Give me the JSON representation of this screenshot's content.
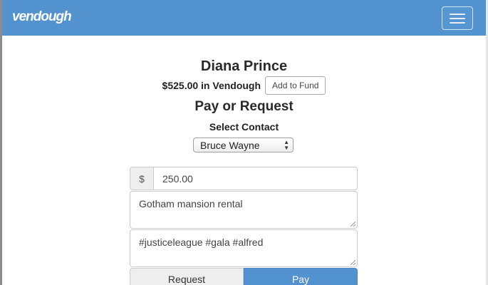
{
  "navbar": {
    "brand": "vendough",
    "menu_icon": "hamburger-icon",
    "background_color": "#5292cf"
  },
  "profile": {
    "name": "Diana Prince",
    "balance_text": "$525.00 in Vendough",
    "fund_button_label": "Add to Fund"
  },
  "transaction": {
    "title": "Pay or Request",
    "select_label": "Select Contact",
    "selected_contact": "Bruce Wayne",
    "currency_symbol": "$",
    "amount_value": "250.00",
    "description_value": "Gotham mansion rental",
    "tags_value": "#justiceleague #gala #alfred",
    "request_button_label": "Request",
    "pay_button_label": "Pay",
    "pay_button_color": "#5292cf"
  }
}
